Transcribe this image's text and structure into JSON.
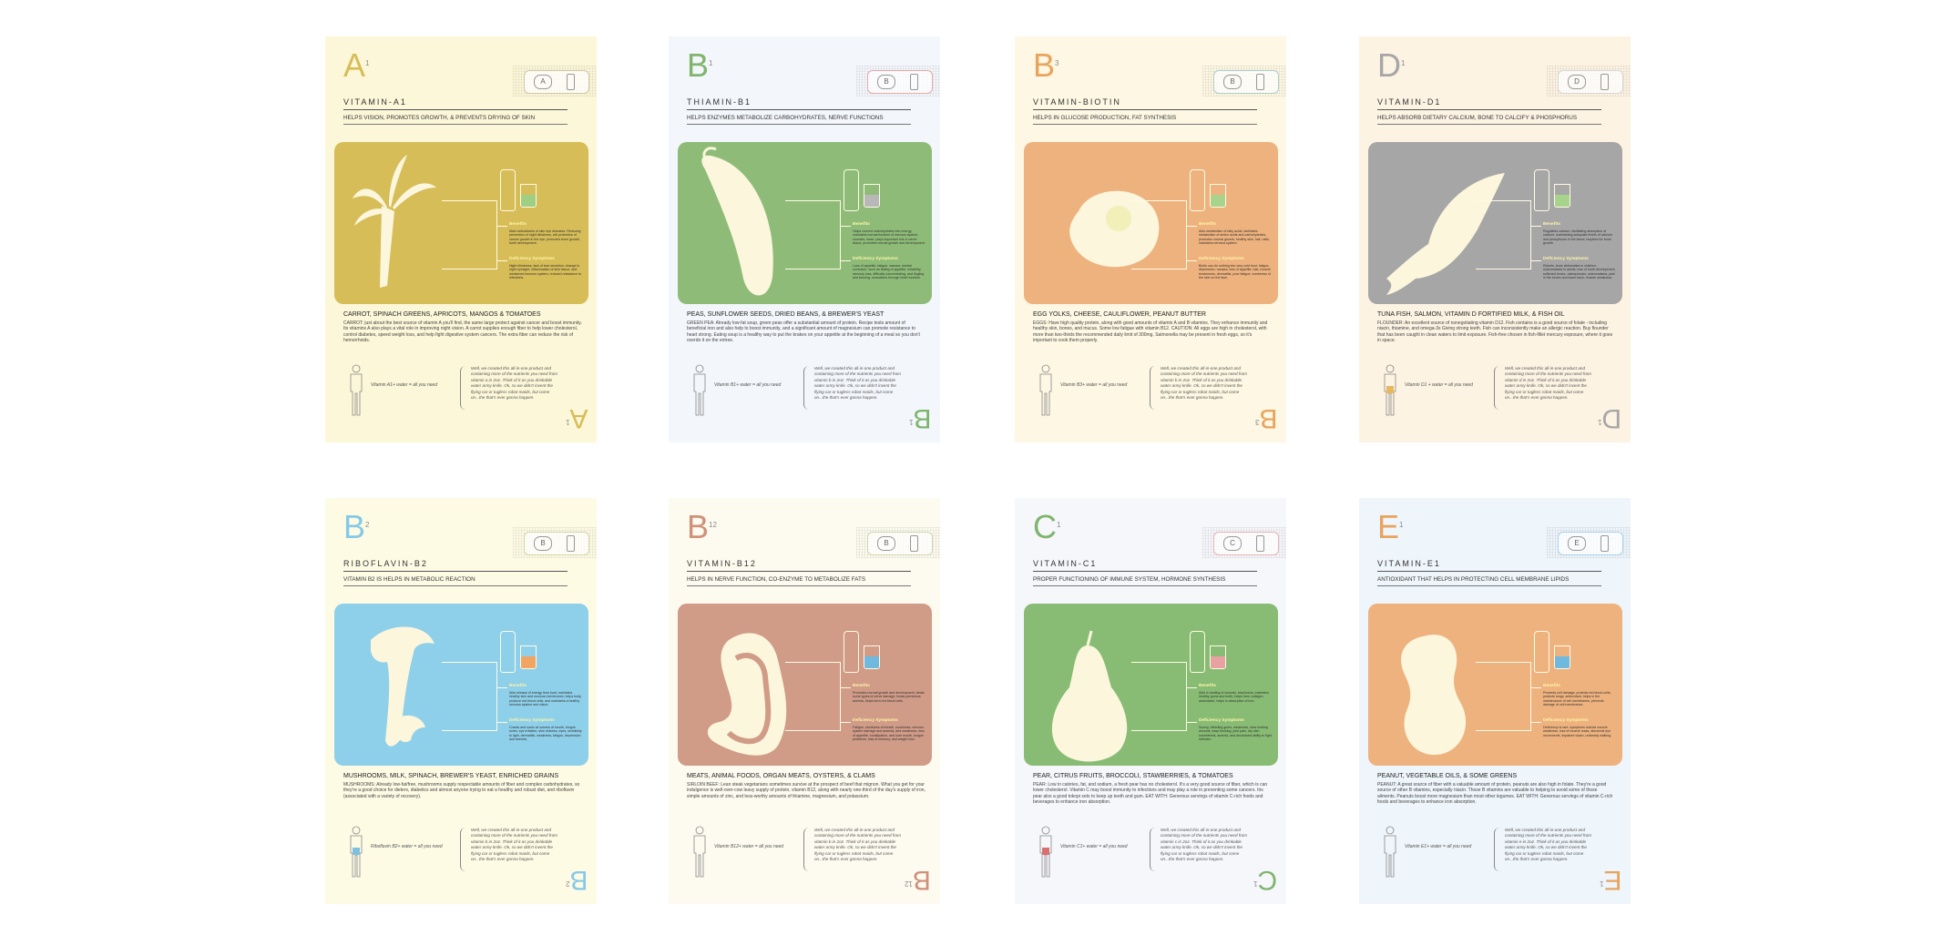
{
  "colors": {
    "ink": "#333333",
    "panel_line": "#fffbe6",
    "label": "#fff6a8"
  },
  "cards": [
    {
      "letter": "A",
      "sup": "1",
      "name": "VITAMIN-A1",
      "function": "HELPS VISION, PROMOTES GROWTH, & PREVENTS DRYING OF SKIN",
      "foods": "CARROT, SPINACH GREENS, APRICOTS, MANGOS & TOMATOES",
      "desc": "CARROT: just about the best source of vitamin A you'll find, the same large protect against cancer and boost immunity. Its vitamins A also plays a vital role in improving night vision. A carrot supplies enough fiber to help lower cholesterol, control diabetes, speed weight loss, and help fight digestive system cancers. The extra fiber can reduce the risk of hemorrhoids.",
      "eq": "Vitamin A1+ water = all you need",
      "note": "Well, we created this all-in-one product and containing more of the nutrients you need from vitamin a in 2oz. Think of it as you drinkable water army knife. Ok, so we didn't invent the flying car or tugless robot maids, but come on...the that's ever gonna happen.",
      "benefits_label": "Benefits",
      "benefits": "Main antioxidants of skin eye diseases. Reducing prevention of night blindness, cell protection of cancer growth in the eye, promotes bone growth, tooth development.",
      "deficiency_label": "Deficiency Symptoms",
      "deficiency": "Night blindness, lack of tear secretion, change in night eyesight, inflammation of skin tissue, and weakened immune system, reduced resistance to infections.",
      "bg": "#fdf7d9",
      "panel": "#d6bd58",
      "accent": "#d6bd58",
      "cup": "#9fcf83"
    },
    {
      "letter": "B",
      "sup": "1",
      "name": "THIAMIN-B1",
      "function": "HELPS ENZYMES METABOLIZE CARBOHYDRATES, NERVE FUNCTIONS",
      "foods": "PEAS, SUNFLOWER SEEDS, DRIED BEANS, & BREWER'S YEAST",
      "desc": "GREEN PEA: Already low-fat soup, green peas offer a substantial amount of protein. Recipe tests amount of beneficial iron and also help to boost immunity, and a significant amount of magnesium can promote resistance to heart strong. Eating soup is a healthy way to put the brakes on your appetite at the beginning of a meal so you don't overdo it on the entree.",
      "eq": "Vitamin B1+ water = all you need",
      "note": "Well, we created this all-in-one product and containing more of the nutrients you need from vitamin b in 2oz. Think of it as you drinkable water army knife. Ok, so we didn't invent the flying car or tugless robot maids, but come on...the that's ever gonna happen.",
      "benefits_label": "Benefits",
      "benefits": "Helps convert carbohydrates into energy, maintains normal function of nervous system, muscles, heart, plays important role in nerve tissue, promotes normal growth and development.",
      "deficiency_label": "Deficiency Symptoms",
      "deficiency": "Loss of appetite, fatigue, nausea, mental confusion, such as fading of appetite, irritability, memory loss, difficulty concentrating, and tingling and burning, sensations through heart function.",
      "bg": "#f3f6fb",
      "panel": "#8ebc78",
      "accent": "#7fb56c",
      "cup": "#b8b8b8"
    },
    {
      "letter": "B",
      "sup": "3",
      "name": "VITAMIN-BIOTIN",
      "function": "HELPS IN GLUCOSE PRODUCTION, FAT SYNTHESIS",
      "foods": "EGG YOLKS, CHEESE, CAULIFLOWER, PEANUT BUTTER",
      "desc": "EGGS: Have high quality protein, along with good amounts of vitamin A and B vitamins. They enhance immunity and healthy skin, bones, and mucus. Some low fatigue with vitamin B12. CAUTION: All eggs are high in cholesterol, with more than two-thirds the recommended daily limit of 300mg. Salmonella may be present in fresh eggs, so it's important to cook them properly.",
      "eq": "Vitamin B3+ water = all you need",
      "note": "Well, we created this all-in-one product and containing more of the nutrients you need from vitamin b in 2oz. Think of it as you drinkable water army knife. Ok, so we didn't invent the flying car or tugless robot maids, but come on...the that's ever gonna happen.",
      "benefits_label": "Benefits",
      "benefits": "Aids metabolism of fatty acids, facilitates metabolism of amino acids and carbohydrates, promotes normal growth, healthy skin, hair, nails, maintains nervous system.",
      "deficiency_label": "Deficiency Symptoms",
      "deficiency": "Biotin can do nothing into very cold food, fatigue, depression, nausea, loss of appetite, hair, muscle tenderness, dermatitis, poor fatigue, numbness of the skin on the face.",
      "bg": "#fdf7e3",
      "panel": "#eeb27e",
      "accent": "#e8a45c",
      "cup": "#a7d38a"
    },
    {
      "letter": "D",
      "sup": "1",
      "name": "VITAMIN-D1",
      "function": "HELPS ABSORB DIETARY CALCIUM, BONE TO CALCIFY & PHOSPHORUS",
      "foods": "TUNA FISH, SALMON, VITAMIN D FORTIFIED MILK, & FISH OIL",
      "desc": "FLOUNDER: An excellent source of nonegotiating vitamin D12. Fish contains is a good source of folate - including niacin, thiamine, and omega-3s Giving strong teeth. Fish can inconsistently make an allergic reaction. Buy flounder that has been caught in clean waters to limit exposure. Fish-free chosen in fish-fillet mercury exposure, where it goes in space.",
      "eq": "Vitamin D1 + water = all you need",
      "note": "Well, we created this all-in-one product and containing more of the nutrients you need from vitamin d in 2oz. Think of it as you drinkable water army knife. Ok, so we didn't invent the flying car or tugless robot maids, but come on...the that's ever gonna happen.",
      "benefits_label": "Benefits",
      "benefits": "Regulates calcium, facilitating absorption of calcium, maintaining adequate levels of calcium and phosphorus in the blood, required for bone growth.",
      "deficiency_label": "Deficiency Symptoms",
      "deficiency": "Rickets, bone deformities in children, osteomalacia in adults, loss of tooth development, softened bones, osteoporosis, osteomalacia, pain in the bones and lower back, muscle weakness.",
      "bg": "#fdf3e3",
      "panel": "#a6a6a6",
      "accent": "#a6a6a6",
      "cup": "#a7d38a"
    },
    {
      "letter": "B",
      "sup": "2",
      "name": "RIBOFLAVIN-B2",
      "function": "VITAMIN B2 IS HELPS IN METABOLIC REACTION",
      "foods": "MUSHROOMS, MILK, SPINACH, BREWER'S YEAST, ENRICHED GRAINS",
      "desc": "MUSHROOMS: Already low-fat/free, mushrooms supply respectable amounts of fiber and complex carbohydrates, so they're a good choice for dieters, diabetics and almost anyone trying to eat a healthy and robust diet, and riboflavin (associated with a variety of recovery).",
      "eq": "Riboflavin B2+ water = all you need",
      "note": "Well, we created this all-in-one product and containing more of the nutrients you need from vitamin b in 2oz. Think of it as you drinkable water army knife. Ok, so we didn't invent the flying car or tugless robot maids, but come on...the that's ever gonna happen.",
      "benefits_label": "Benefits",
      "benefits": "Aids release of energy from food, maintains healthy skin and mucous membranes, helps body produce red blood cells, and maintains a healthy nervous system and vision.",
      "deficiency_label": "Deficiency Symptoms",
      "deficiency": "Cracks and sores at corners of mouth, tongue sores, eye irritation, skin redness, eyes, sensitivity to light, dermatitis, weakness, fatigue, depression and anemia.",
      "bg": "#fefbe5",
      "panel": "#8ecfe9",
      "accent": "#85c9e8",
      "cup": "#f2a462"
    },
    {
      "letter": "B",
      "sup": "12",
      "name": "VITAMIN-B12",
      "function": "HELPS IN NERVE FUNCTION, CO-ENZYME TO METABOLIZE FATS",
      "foods": "MEATS, ANIMAL FOODS, ORGAN MEATS, OYSTERS, & CLAMS",
      "desc": "SIRLOIN BEEF: Lean steak vegetarians sometimes survive at the prospect of beef that mignon. What you get for your indulgence is well-over-cow leavy supply of protein, vitamin B12, along with nearly one-third of the day's supply of iron, simple amounts of zinc, and less-worthy amounts of thiamine, magnesium, and potassium.",
      "eq": "Vitamin B12+ water = all you need",
      "note": "Well, we created this all-in-one product and containing more of the nutrients you need from vitamin b in 2oz. Think of it as you drinkable water army knife. Ok, so we didn't invent the flying car or tugless robot maids, but come on...the that's ever gonna happen.",
      "benefits_label": "Benefits",
      "benefits": "Promotes normal growth and development, treats some types of nerve damage, treats pernicious anemia, helps form red blood cells.",
      "deficiency_label": "Deficiency Symptoms",
      "deficiency": "Fatigue, shortness of breath, numbness, nervous system damage and anemia, and weakness, loss of appetite, constipation, and sore mouth, tongue problems, loss of memory, and weight loss.",
      "bg": "#fdfbef",
      "panel": "#d09b87",
      "accent": "#d0907a",
      "cup": "#6fb8de"
    },
    {
      "letter": "C",
      "sup": "1",
      "name": "VITAMIN-C1",
      "function": "PROPER FUNCTIONING OF IMMUNE SYSTEM, HORMONE SYNTHESIS",
      "foods": "PEAR, CITRUS FRUITS, BROCCOLI, STAWBERRIES, & TOMATOES",
      "desc": "PEAR: Low in calories, fat, and sodium, a fresh pear has no cholesterol. It's a very good source of fiber, which is can lower cholesterol. Vitamin C may boost immunity to infections and may play a role in preventing some cancers. Iris pear also a good tokopi sets to keep up teeth and gum. EAT WITH: Generous servings of vitamin C-rich foods and beverages to enhance iron absorption.",
      "eq": "Vitamin C1+ water = all you need",
      "note": "Well, we created this all-in-one product and containing more of the nutrients you need from vitamin c in 2oz. Think of it as you drinkable water army knife. Ok, so we didn't invent the flying car or tugless robot maids, but come on...the that's ever gonna happen.",
      "benefits_label": "Benefits",
      "benefits": "Aids in healing of wounds, heal burns, maintains healthy gums and teeth, helps form collagen, antioxidant, helps in absorption of iron.",
      "deficiency_label": "Deficiency Symptoms",
      "deficiency": "Scurvy, bleeding gums, weakness, slow healing wounds, easy bruising, joint pain, dry skin, nosebleeds, anemia, and decreased ability to fight infection.",
      "bg": "#f6f7fb",
      "panel": "#88bc74",
      "accent": "#7fb56c",
      "cup": "#e8a0a0"
    },
    {
      "letter": "E",
      "sup": "1",
      "name": "VITAMIN-E1",
      "function": "ANTIOXIDANT THAT HELPS IN PROTECTING CELL MEMBRANE LIPIDS",
      "foods": "PEANUT, VEGETABLE OILS, & SOME GREENS",
      "desc": "PEANUT: A great source of fiber with a valuable amount of protein, peanuts are also high in folate. They're a good source of other B vitamins, especially niacin. Those B vitamins are valuable to helping to avoid some of those ailments. Peanuts boost more magnesium than most other legumes. EAT WITH: Generous servings of vitamin C-rich foods and beverages to enhance iron absorption.",
      "eq": "Vitamin E1+ water = all you need",
      "note": "Well, we created this all-in-one product and containing more of the nutrients you need from vitamin e in 2oz. Think of it as you drinkable water army knife. Ok, so we didn't invent the flying car or tugless robot maids, but come on...the that's ever gonna happen.",
      "benefits_label": "Benefits",
      "benefits": "Prevents cell damage, protects red blood cells, protects lungs, antioxidant, helps in the maintenance of cell membranes, prevents damage of cell membranes.",
      "deficiency_label": "Deficiency Symptoms",
      "deficiency": "Deficiency is rare, symptoms include muscle weakness, loss of muscle mass, abnormal eye movements, impaired vision, unsteady walking.",
      "bg": "#eef5fb",
      "panel": "#eeb27e",
      "accent": "#e8a45c",
      "cup": "#6fb8de"
    }
  ]
}
